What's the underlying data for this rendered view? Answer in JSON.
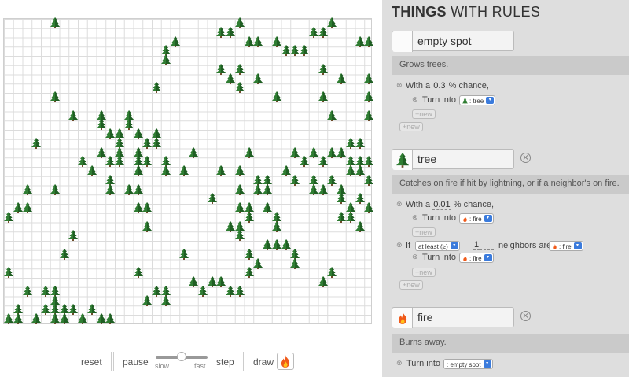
{
  "panel": {
    "title_bold": "THINGS",
    "title_rest": " WITH RULES",
    "things": [
      {
        "name": "empty spot",
        "icon": "blank",
        "description": "Grows trees.",
        "rules": [
          {
            "kind": "chance",
            "prefix": "With a",
            "value": "0.3",
            "suffix": "% chance,",
            "action": "Turn into",
            "target": ": tree",
            "target_icon": "tree-icon"
          }
        ],
        "new_label": "+new",
        "new_label_outer": "+new"
      },
      {
        "name": "tree",
        "icon": "tree-icon",
        "description": "Catches on fire if hit by lightning, or if a neighbor's on fire.",
        "rules": [
          {
            "kind": "chance",
            "prefix": "With a",
            "value": "0.01",
            "suffix": "% chance,",
            "action": "Turn into",
            "target": ": fire",
            "target_icon": "fire-icon"
          },
          {
            "kind": "if",
            "prefix": "If",
            "comparator": "at least (≥)",
            "count": "1",
            "mid": "neighbors are",
            "neighbor": ": fire",
            "neighbor_icon": "fire-icon",
            "action": "Turn into",
            "target": ": fire",
            "target_icon": "fire-icon"
          }
        ],
        "new_label": "+new",
        "new_label_inner": "+new",
        "new_label_outer": "+new"
      },
      {
        "name": "fire",
        "icon": "fire-icon",
        "description": "Burns away.",
        "rules": [
          {
            "kind": "plain",
            "action": "Turn into",
            "target": ": empty spot",
            "target_icon": "blank"
          }
        ]
      }
    ]
  },
  "controls": {
    "reset": "reset",
    "pause": "pause",
    "slow": "slow",
    "fast": "fast",
    "step": "step",
    "draw": "draw",
    "draw_icon": "fire-icon",
    "speed_fraction": 0.5
  },
  "grid": {
    "cols": 40,
    "rows": 33,
    "trees": [
      [
        5,
        0
      ],
      [
        23,
        1
      ],
      [
        24,
        1
      ],
      [
        25,
        0
      ],
      [
        27,
        2
      ],
      [
        33,
        1
      ],
      [
        34,
        1
      ],
      [
        35,
        0
      ],
      [
        38,
        2
      ],
      [
        39,
        2
      ],
      [
        18,
        2
      ],
      [
        17,
        3
      ],
      [
        26,
        2
      ],
      [
        29,
        2
      ],
      [
        31,
        3
      ],
      [
        32,
        3
      ],
      [
        30,
        3
      ],
      [
        17,
        4
      ],
      [
        25,
        5
      ],
      [
        24,
        6
      ],
      [
        27,
        6
      ],
      [
        23,
        5
      ],
      [
        34,
        5
      ],
      [
        36,
        6
      ],
      [
        39,
        6
      ],
      [
        25,
        7
      ],
      [
        16,
        7
      ],
      [
        5,
        8
      ],
      [
        29,
        8
      ],
      [
        34,
        8
      ],
      [
        39,
        8
      ],
      [
        7,
        10
      ],
      [
        10,
        10
      ],
      [
        13,
        10
      ],
      [
        35,
        10
      ],
      [
        39,
        10
      ],
      [
        10,
        11
      ],
      [
        13,
        11
      ],
      [
        12,
        12
      ],
      [
        14,
        12
      ],
      [
        16,
        12
      ],
      [
        11,
        12
      ],
      [
        3,
        13
      ],
      [
        12,
        13
      ],
      [
        10,
        14
      ],
      [
        15,
        13
      ],
      [
        37,
        13
      ],
      [
        38,
        13
      ],
      [
        12,
        14
      ],
      [
        14,
        14
      ],
      [
        16,
        13
      ],
      [
        20,
        14
      ],
      [
        26,
        14
      ],
      [
        31,
        14
      ],
      [
        33,
        14
      ],
      [
        35,
        14
      ],
      [
        36,
        14
      ],
      [
        8,
        15
      ],
      [
        11,
        15
      ],
      [
        12,
        15
      ],
      [
        14,
        15
      ],
      [
        15,
        15
      ],
      [
        17,
        15
      ],
      [
        32,
        15
      ],
      [
        34,
        15
      ],
      [
        37,
        15
      ],
      [
        38,
        15
      ],
      [
        39,
        15
      ],
      [
        9,
        16
      ],
      [
        14,
        16
      ],
      [
        17,
        16
      ],
      [
        19,
        16
      ],
      [
        23,
        16
      ],
      [
        25,
        16
      ],
      [
        30,
        16
      ],
      [
        37,
        16
      ],
      [
        38,
        16
      ],
      [
        27,
        17
      ],
      [
        28,
        17
      ],
      [
        31,
        17
      ],
      [
        33,
        17
      ],
      [
        35,
        17
      ],
      [
        39,
        17
      ],
      [
        2,
        18
      ],
      [
        5,
        18
      ],
      [
        11,
        17
      ],
      [
        13,
        18
      ],
      [
        14,
        18
      ],
      [
        11,
        18
      ],
      [
        25,
        18
      ],
      [
        27,
        18
      ],
      [
        28,
        18
      ],
      [
        33,
        18
      ],
      [
        34,
        18
      ],
      [
        36,
        18
      ],
      [
        36,
        19
      ],
      [
        38,
        19
      ],
      [
        22,
        19
      ],
      [
        2,
        20
      ],
      [
        25,
        20
      ],
      [
        26,
        20
      ],
      [
        37,
        20
      ],
      [
        39,
        20
      ],
      [
        0,
        21
      ],
      [
        1,
        20
      ],
      [
        14,
        20
      ],
      [
        15,
        20
      ],
      [
        28,
        20
      ],
      [
        29,
        21
      ],
      [
        36,
        21
      ],
      [
        37,
        21
      ],
      [
        15,
        22
      ],
      [
        26,
        21
      ],
      [
        25,
        22
      ],
      [
        38,
        22
      ],
      [
        7,
        23
      ],
      [
        24,
        22
      ],
      [
        29,
        22
      ],
      [
        25,
        23
      ],
      [
        28,
        24
      ],
      [
        29,
        24
      ],
      [
        30,
        24
      ],
      [
        26,
        25
      ],
      [
        19,
        25
      ],
      [
        6,
        25
      ],
      [
        31,
        25
      ],
      [
        27,
        26
      ],
      [
        31,
        26
      ],
      [
        0,
        27
      ],
      [
        14,
        27
      ],
      [
        26,
        27
      ],
      [
        20,
        28
      ],
      [
        22,
        28
      ],
      [
        23,
        28
      ],
      [
        34,
        28
      ],
      [
        35,
        27
      ],
      [
        2,
        29
      ],
      [
        4,
        29
      ],
      [
        5,
        29
      ],
      [
        16,
        29
      ],
      [
        17,
        29
      ],
      [
        21,
        29
      ],
      [
        24,
        29
      ],
      [
        25,
        29
      ],
      [
        5,
        30
      ],
      [
        15,
        30
      ],
      [
        17,
        30
      ],
      [
        1,
        31
      ],
      [
        4,
        31
      ],
      [
        5,
        31
      ],
      [
        6,
        31
      ],
      [
        7,
        31
      ],
      [
        9,
        31
      ],
      [
        0,
        32
      ],
      [
        1,
        32
      ],
      [
        3,
        32
      ],
      [
        5,
        32
      ],
      [
        6,
        32
      ],
      [
        8,
        32
      ],
      [
        10,
        32
      ],
      [
        11,
        32
      ]
    ]
  }
}
